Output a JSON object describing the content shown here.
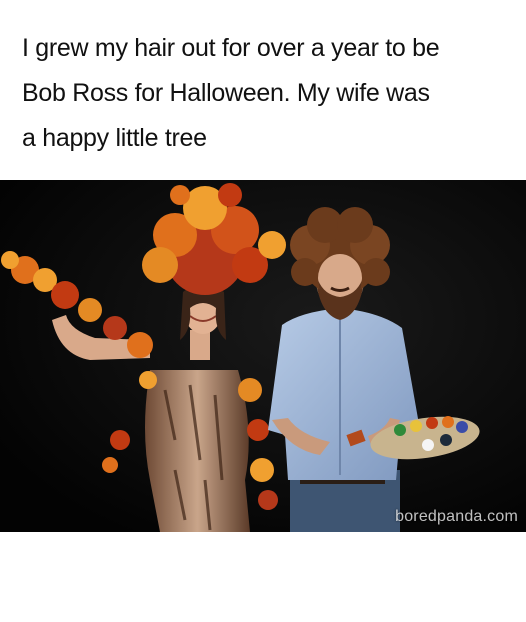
{
  "caption": {
    "line1": "I grew my hair out for over a year to be",
    "line2": "Bob Ross for Halloween. My wife was",
    "line3": "a happy little tree"
  },
  "photo": {
    "watermark": "boredpanda.com",
    "background_color": "#050505",
    "leaf_colors": [
      "#c23a12",
      "#e0701c",
      "#f0a030",
      "#8a2a10"
    ],
    "shirt_color": "#9fb7d8",
    "hair_color": "#6b3b1c"
  }
}
